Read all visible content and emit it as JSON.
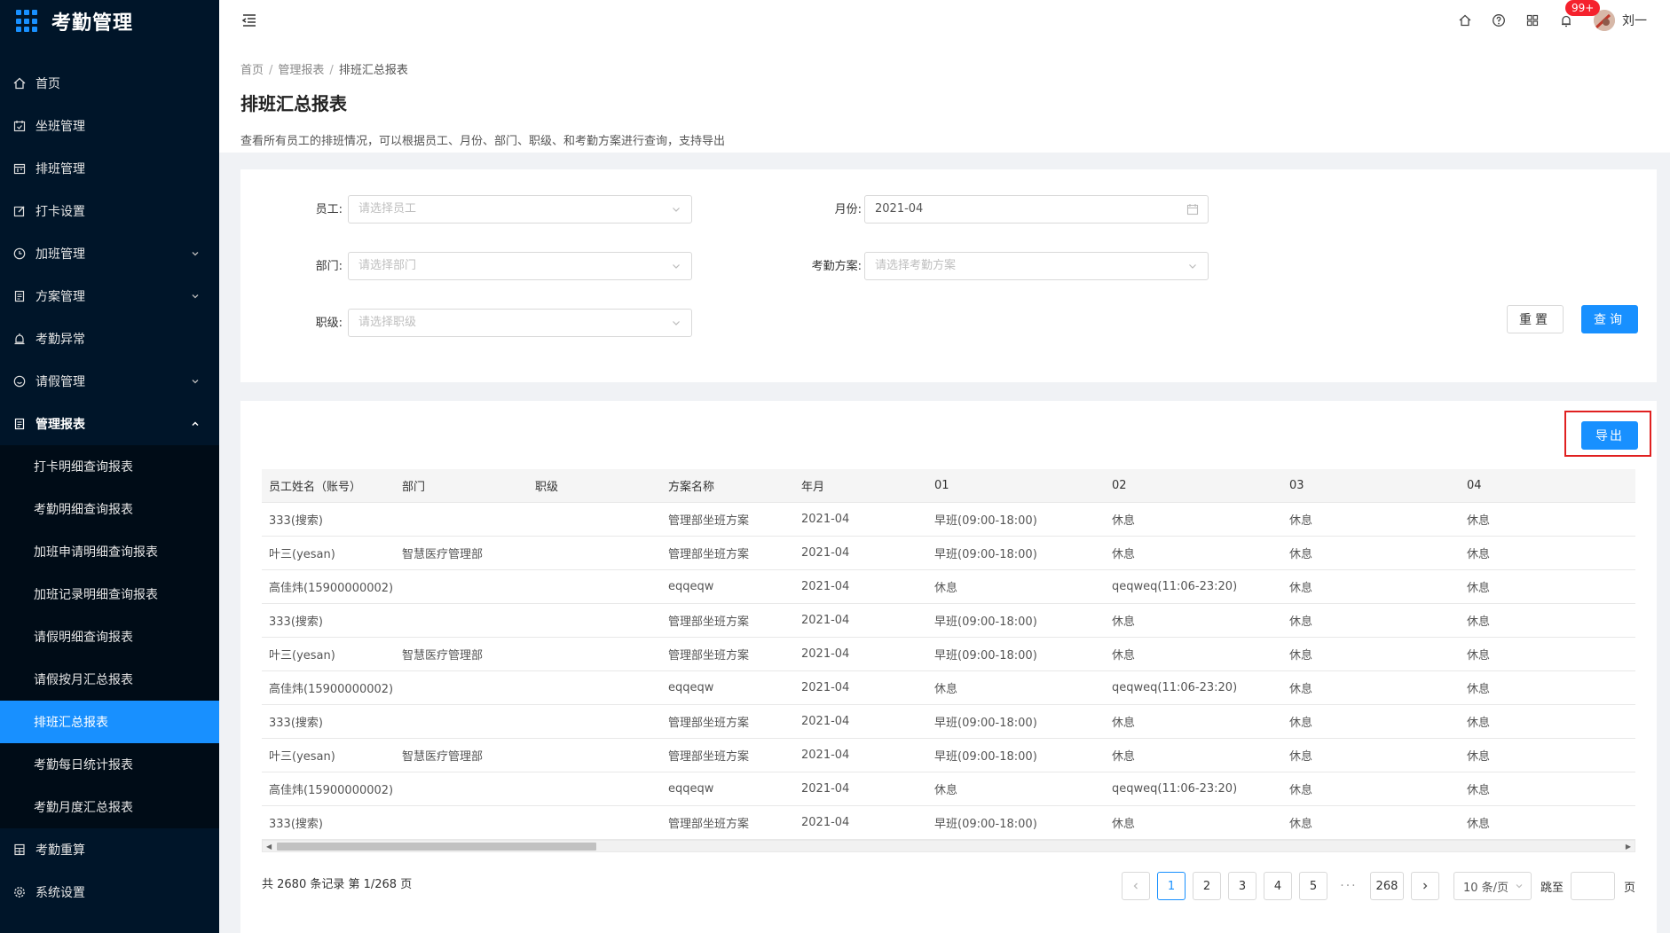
{
  "app": {
    "title": "考勤管理"
  },
  "sidebar": {
    "items": [
      {
        "label": "首页",
        "icon": "home-icon"
      },
      {
        "label": "坐班管理",
        "icon": "calendar-check-icon"
      },
      {
        "label": "排班管理",
        "icon": "schedule-icon"
      },
      {
        "label": "打卡设置",
        "icon": "edit-icon"
      },
      {
        "label": "加班管理",
        "icon": "clock-icon"
      },
      {
        "label": "方案管理",
        "icon": "document-icon"
      },
      {
        "label": "考勤异常",
        "icon": "alarm-icon"
      },
      {
        "label": "请假管理",
        "icon": "smile-icon"
      },
      {
        "label": "管理报表",
        "icon": "report-icon"
      }
    ],
    "submenu": [
      "打卡明细查询报表",
      "考勤明细查询报表",
      "加班申请明细查询报表",
      "加班记录明细查询报表",
      "请假明细查询报表",
      "请假按月汇总报表",
      "排班汇总报表",
      "考勤每日统计报表",
      "考勤月度汇总报表"
    ],
    "bottom": [
      {
        "label": "考勤重算",
        "icon": "calculator-icon"
      },
      {
        "label": "系统设置",
        "icon": "gear-icon"
      }
    ]
  },
  "header": {
    "badge": "99+",
    "user": "刘一"
  },
  "breadcrumb": {
    "home": "首页",
    "parent": "管理报表",
    "current": "排班汇总报表"
  },
  "page": {
    "title": "排班汇总报表",
    "desc": "查看所有员工的排班情况，可以根据员工、月份、部门、职级、和考勤方案进行查询，支持导出"
  },
  "filters": {
    "employee_label": "员工:",
    "employee_placeholder": "请选择员工",
    "month_label": "月份:",
    "month_value": "2021-04",
    "dept_label": "部门:",
    "dept_placeholder": "请选择部门",
    "plan_label": "考勤方案:",
    "plan_placeholder": "请选择考勤方案",
    "level_label": "职级:",
    "level_placeholder": "请选择职级",
    "reset": "重置",
    "query": "查询"
  },
  "export_label": "导出",
  "table": {
    "columns": [
      "员工姓名（账号）",
      "部门",
      "职级",
      "方案名称",
      "年月",
      "01",
      "02",
      "03",
      "04"
    ],
    "rows": [
      [
        "333(搜索)",
        "",
        "",
        "管理部坐班方案",
        "2021-04",
        "早班(09:00-18:00)",
        "休息",
        "休息",
        "休息"
      ],
      [
        "叶三(yesan)",
        "智慧医疗管理部",
        "",
        "管理部坐班方案",
        "2021-04",
        "早班(09:00-18:00)",
        "休息",
        "休息",
        "休息"
      ],
      [
        "高佳炜(15900000002)",
        "",
        "",
        "eqqeqw",
        "2021-04",
        "休息",
        "qeqweq(11:06-23:20)",
        "休息",
        "休息"
      ],
      [
        "333(搜索)",
        "",
        "",
        "管理部坐班方案",
        "2021-04",
        "早班(09:00-18:00)",
        "休息",
        "休息",
        "休息"
      ],
      [
        "叶三(yesan)",
        "智慧医疗管理部",
        "",
        "管理部坐班方案",
        "2021-04",
        "早班(09:00-18:00)",
        "休息",
        "休息",
        "休息"
      ],
      [
        "高佳炜(15900000002)",
        "",
        "",
        "eqqeqw",
        "2021-04",
        "休息",
        "qeqweq(11:06-23:20)",
        "休息",
        "休息"
      ],
      [
        "333(搜索)",
        "",
        "",
        "管理部坐班方案",
        "2021-04",
        "早班(09:00-18:00)",
        "休息",
        "休息",
        "休息"
      ],
      [
        "叶三(yesan)",
        "智慧医疗管理部",
        "",
        "管理部坐班方案",
        "2021-04",
        "早班(09:00-18:00)",
        "休息",
        "休息",
        "休息"
      ],
      [
        "高佳炜(15900000002)",
        "",
        "",
        "eqqeqw",
        "2021-04",
        "休息",
        "qeqweq(11:06-23:20)",
        "休息",
        "休息"
      ],
      [
        "333(搜索)",
        "",
        "",
        "管理部坐班方案",
        "2021-04",
        "早班(09:00-18:00)",
        "休息",
        "休息",
        "休息"
      ]
    ]
  },
  "pagination": {
    "summary": "共 2680 条记录 第 1/268 页",
    "pages": [
      "1",
      "2",
      "3",
      "4",
      "5"
    ],
    "ellipsis": "···",
    "last": "268",
    "page_size": "10 条/页",
    "jump_label": "跳至",
    "jump_suffix": "页"
  }
}
